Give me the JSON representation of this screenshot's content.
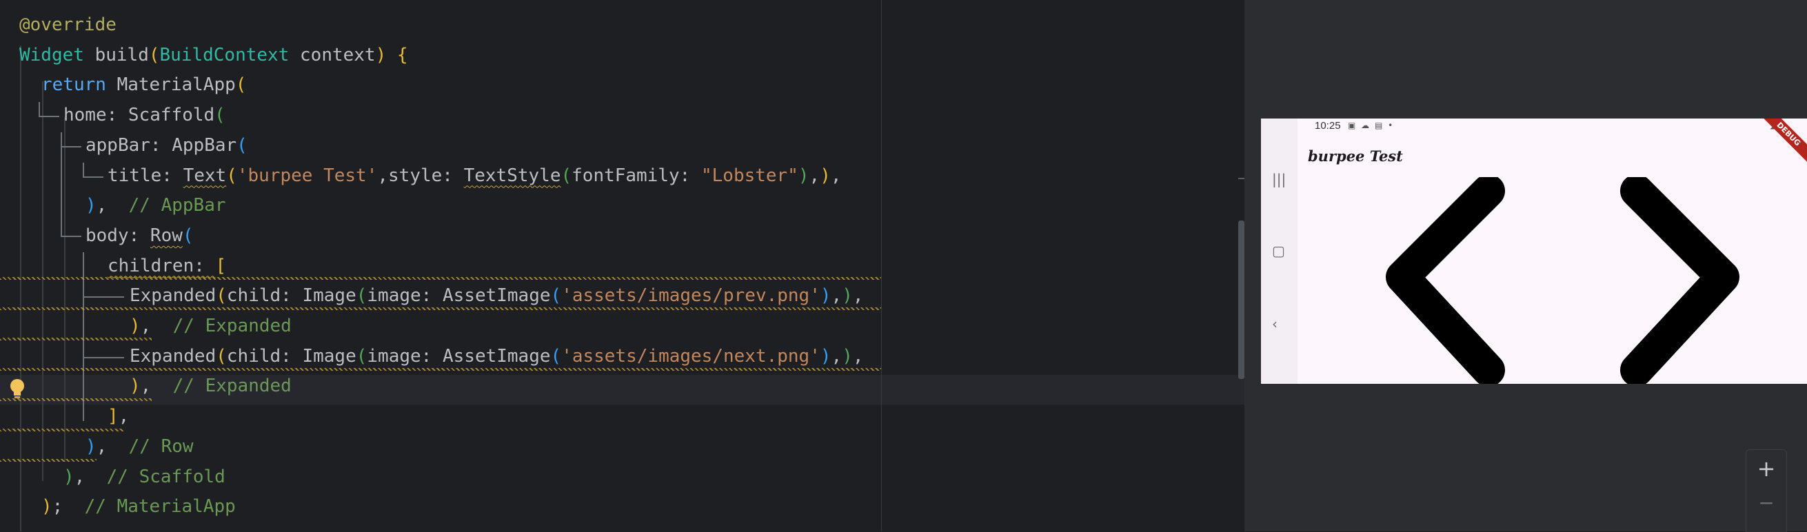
{
  "editor": {
    "lines": [
      [
        {
          "t": "@override",
          "c": "ann"
        }
      ],
      [
        {
          "t": "Widget ",
          "c": "type"
        },
        {
          "t": "build",
          "c": "id"
        },
        {
          "t": "(",
          "c": "p1"
        },
        {
          "t": "BuildContext ",
          "c": "type"
        },
        {
          "t": "context",
          "c": "id"
        },
        {
          "t": ") {",
          "c": "p1"
        }
      ],
      [
        {
          "t": "return ",
          "c": "kw2"
        },
        {
          "t": "MaterialApp",
          "c": "id"
        },
        {
          "t": "(",
          "c": "p1"
        }
      ],
      [
        {
          "t": "home: ",
          "c": "id"
        },
        {
          "t": "Scaffold",
          "c": "id"
        },
        {
          "t": "(",
          "c": "p2"
        }
      ],
      [
        {
          "t": "appBar: ",
          "c": "id"
        },
        {
          "t": "AppBar",
          "c": "id"
        },
        {
          "t": "(",
          "c": "p3"
        }
      ],
      [
        {
          "t": "title: ",
          "c": "id"
        },
        {
          "t": "Text",
          "c": "id u"
        },
        {
          "t": "(",
          "c": "p1"
        },
        {
          "t": "'burpee Test'",
          "c": "str"
        },
        {
          "t": ",style: ",
          "c": "id"
        },
        {
          "t": "TextStyle",
          "c": "id u"
        },
        {
          "t": "(",
          "c": "p2"
        },
        {
          "t": "fontFamily: ",
          "c": "id"
        },
        {
          "t": "\"Lobster\"",
          "c": "str"
        },
        {
          "t": ")",
          "c": "p2"
        },
        {
          "t": ",",
          "c": "id"
        },
        {
          "t": ")",
          "c": "p1"
        },
        {
          "t": ",",
          "c": "id"
        }
      ],
      [
        {
          "t": ")",
          "c": "p3"
        },
        {
          "t": ",  ",
          "c": "id"
        },
        {
          "t": "// AppBar",
          "c": "cmt"
        }
      ],
      [
        {
          "t": "body: ",
          "c": "id"
        },
        {
          "t": "Row",
          "c": "id u"
        },
        {
          "t": "(",
          "c": "p3"
        }
      ],
      [
        {
          "t": "children: ",
          "c": "id u"
        },
        {
          "t": "[",
          "c": "p1"
        }
      ],
      [
        {
          "t": "Expanded",
          "c": "id"
        },
        {
          "t": "(",
          "c": "p1"
        },
        {
          "t": "child: ",
          "c": "id"
        },
        {
          "t": "Image",
          "c": "id"
        },
        {
          "t": "(",
          "c": "p2"
        },
        {
          "t": "image: ",
          "c": "id"
        },
        {
          "t": "AssetImage",
          "c": "id"
        },
        {
          "t": "(",
          "c": "p3"
        },
        {
          "t": "'assets/images/prev.png'",
          "c": "str"
        },
        {
          "t": ")",
          "c": "p3"
        },
        {
          "t": ",",
          "c": "id"
        },
        {
          "t": ")",
          "c": "p2"
        },
        {
          "t": ",",
          "c": "id"
        }
      ],
      [
        {
          "t": ")",
          "c": "p1"
        },
        {
          "t": ",  ",
          "c": "id"
        },
        {
          "t": "// Expanded",
          "c": "cmt"
        }
      ],
      [
        {
          "t": "Expanded",
          "c": "id"
        },
        {
          "t": "(",
          "c": "p1"
        },
        {
          "t": "child: ",
          "c": "id"
        },
        {
          "t": "Image",
          "c": "id"
        },
        {
          "t": "(",
          "c": "p2"
        },
        {
          "t": "image: ",
          "c": "id"
        },
        {
          "t": "AssetImage",
          "c": "id"
        },
        {
          "t": "(",
          "c": "p3"
        },
        {
          "t": "'assets/images/next.png'",
          "c": "str"
        },
        {
          "t": ")",
          "c": "p3"
        },
        {
          "t": ",",
          "c": "id"
        },
        {
          "t": ")",
          "c": "p2"
        },
        {
          "t": ",",
          "c": "id"
        }
      ],
      [
        {
          "t": ")",
          "c": "p1"
        },
        {
          "t": ",  ",
          "c": "id"
        },
        {
          "t": "// Expanded",
          "c": "cmt"
        }
      ],
      [
        {
          "t": "]",
          "c": "p1"
        },
        {
          "t": ",",
          "c": "id"
        }
      ],
      [
        {
          "t": ")",
          "c": "p3"
        },
        {
          "t": ",  ",
          "c": "id"
        },
        {
          "t": "// Row",
          "c": "cmt"
        }
      ],
      [
        {
          "t": ")",
          "c": "p2"
        },
        {
          "t": ",  ",
          "c": "id"
        },
        {
          "t": "// Scaffold",
          "c": "cmt"
        }
      ],
      [
        {
          "t": ")",
          "c": "p1"
        },
        {
          "t": ";  ",
          "c": "id"
        },
        {
          "t": "// MaterialApp",
          "c": "cmt"
        }
      ]
    ]
  },
  "device": {
    "status_time": "10:25",
    "app_title": "burpee Test",
    "debug_banner": "DEBUG",
    "nav_icons": [
      "recent-apps-icon",
      "home-icon",
      "back-icon"
    ],
    "images": [
      "prev-arrow",
      "next-arrow"
    ]
  },
  "zoom": {
    "in_label": "+",
    "out_label": "−"
  },
  "colors": {
    "editor_bg": "#1e1f22",
    "device_bg": "#fdf7fd",
    "banner": "#b3261e"
  }
}
